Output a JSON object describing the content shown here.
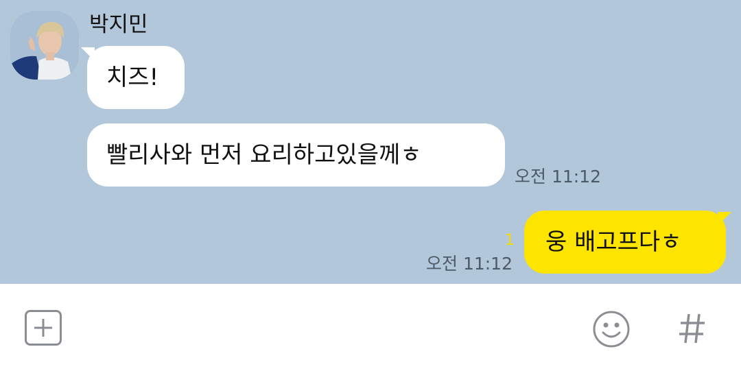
{
  "chat": {
    "sender_name": "박지민",
    "messages": [
      {
        "direction": "in",
        "text": "치즈!"
      },
      {
        "direction": "in",
        "text": "빨리사와 먼저 요리하고있을께ㅎ",
        "time": "오전 11:12"
      },
      {
        "direction": "out",
        "text": "웅 배고프다ㅎ",
        "time": "오전 11:12",
        "unread_count": "1"
      }
    ]
  },
  "input_bar": {
    "attach_icon": "plus-square-icon",
    "emoji_icon": "smiley-icon",
    "hashtag_icon": "hashtag-icon"
  },
  "colors": {
    "chat_background": "#b2c7da",
    "incoming_bubble": "#ffffff",
    "outgoing_bubble": "#fee500",
    "unread_count": "#f2d90a",
    "timestamp": "#4c5966",
    "icon_gray": "#8a8e93"
  }
}
